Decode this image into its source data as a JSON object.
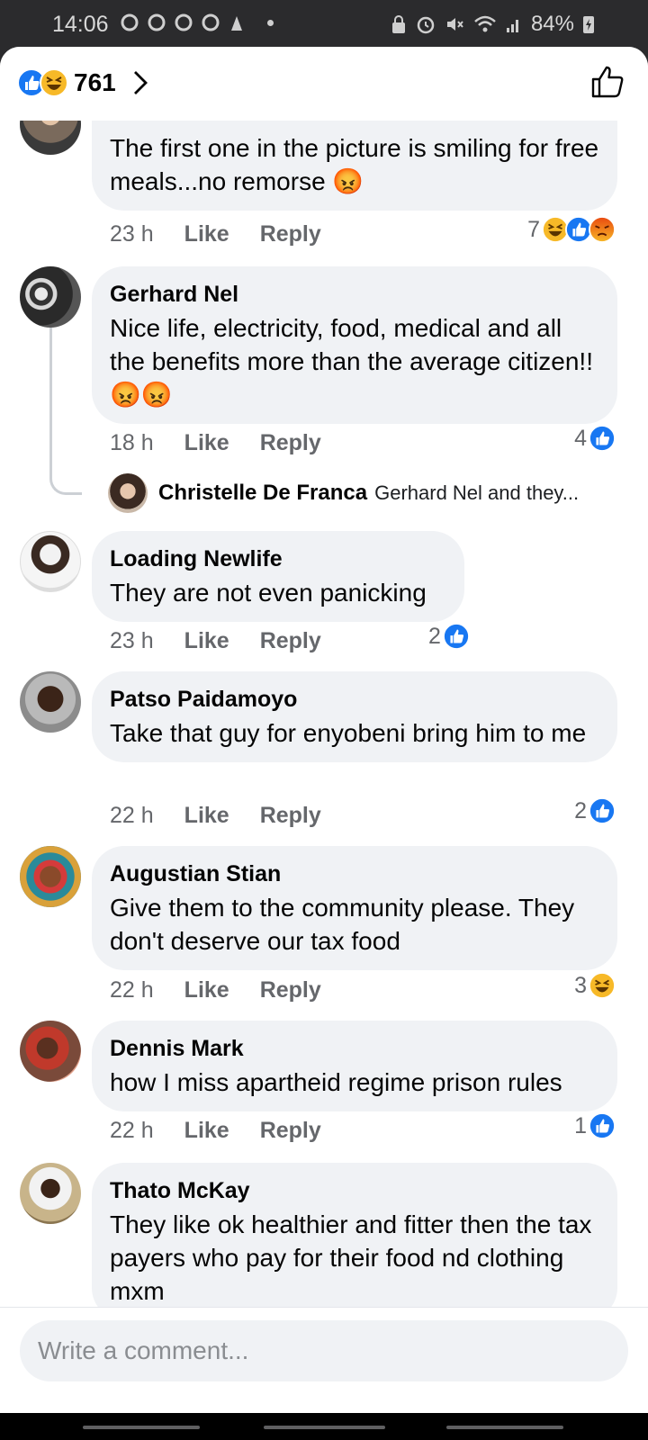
{
  "status_bar": {
    "time": "14:06",
    "battery": "84%"
  },
  "header": {
    "reaction_count": "761",
    "icons": [
      "like-icon",
      "haha-icon",
      "chevron-right-icon",
      "thumbs-up-outline-icon"
    ]
  },
  "comments": [
    {
      "author": "",
      "text": "The first one in the picture is smiling for free meals...no remorse 😡",
      "time": "23 h",
      "like_label": "Like",
      "reply_label": "Reply",
      "reaction_count": "7",
      "reactions": [
        "haha",
        "like",
        "angry"
      ]
    },
    {
      "author": "Gerhard Nel",
      "text": "Nice life, electricity, food, medical and all the benefits more than the average citizen!!😡😡",
      "time": "18 h",
      "like_label": "Like",
      "reply_label": "Reply",
      "reaction_count": "4",
      "reactions": [
        "like"
      ],
      "reply_preview": {
        "author": "Christelle De Franca",
        "snippet": "Gerhard Nel and they..."
      }
    },
    {
      "author": "Loading Newlife",
      "text": "They are not even panicking",
      "time": "23 h",
      "like_label": "Like",
      "reply_label": "Reply",
      "reaction_count": "2",
      "reactions": [
        "like"
      ]
    },
    {
      "author": "Patso Paidamoyo",
      "text": "Take that guy for enyobeni bring him to me",
      "time": "22 h",
      "like_label": "Like",
      "reply_label": "Reply",
      "reaction_count": "2",
      "reactions": [
        "like"
      ]
    },
    {
      "author": "Augustian Stian",
      "text": "Give them to the community please. They don't deserve our tax food",
      "time": "22 h",
      "like_label": "Like",
      "reply_label": "Reply",
      "reaction_count": "3",
      "reactions": [
        "haha"
      ]
    },
    {
      "author": "Dennis Mark",
      "text": "how I miss apartheid regime prison rules",
      "time": "22 h",
      "like_label": "Like",
      "reply_label": "Reply",
      "reaction_count": "1",
      "reactions": [
        "like"
      ]
    },
    {
      "author": "Thato McKay",
      "text": "They like ok healthier and fitter then the tax payers who pay for their food nd clothing mxm"
    }
  ],
  "composer": {
    "placeholder": "Write a comment..."
  },
  "colors": {
    "like_blue": "#1877f2",
    "haha_yellow": "#f7b928",
    "angry_orange": "#e9710f",
    "bubble_bg": "#f0f2f5",
    "meta_gray": "#65676b"
  }
}
